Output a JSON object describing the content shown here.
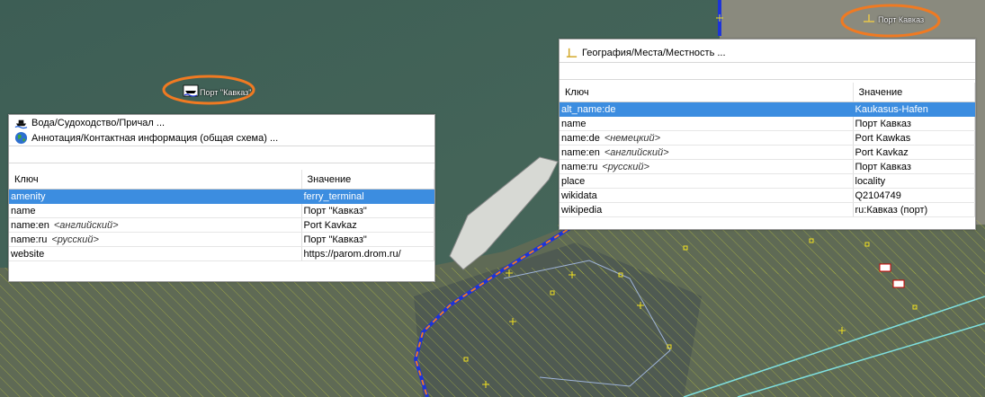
{
  "map": {
    "colors": {
      "sea": "#44665a",
      "land": "#6b735c",
      "highlight": "#f07a22",
      "route": "#1d34d8"
    },
    "labels": [
      {
        "id": "ferry-terminal",
        "text": "Порт \"Кавказ\""
      },
      {
        "id": "locality",
        "text": "Порт Кавказ"
      }
    ]
  },
  "left_panel": {
    "presets": [
      {
        "icon": "ferry-icon",
        "label": "Вода/Судоходство/Причал ..."
      },
      {
        "icon": "globe-icon",
        "label": "Аннотация/Контактная информация (общая схема) ..."
      }
    ],
    "columns": {
      "key": "Ключ",
      "value": "Значение"
    },
    "rows": [
      {
        "key": "amenity",
        "hint": "",
        "value": "ferry_terminal",
        "selected": true
      },
      {
        "key": "name",
        "hint": "",
        "value": "Порт \"Кавказ\"",
        "selected": false
      },
      {
        "key": "name:en",
        "hint": "<английский>",
        "value": "Port Kavkaz",
        "selected": false
      },
      {
        "key": "name:ru",
        "hint": "<русский>",
        "value": "Порт \"Кавказ\"",
        "selected": false
      },
      {
        "key": "website",
        "hint": "",
        "value": "https://parom.drom.ru/",
        "selected": false
      }
    ]
  },
  "right_panel": {
    "presets": [
      {
        "icon": "locality-icon",
        "label": "География/Места/Местность ..."
      }
    ],
    "columns": {
      "key": "Ключ",
      "value": "Значение"
    },
    "rows": [
      {
        "key": "alt_name:de",
        "hint": "",
        "value": "Kaukasus-Hafen",
        "selected": true
      },
      {
        "key": "name",
        "hint": "",
        "value": "Порт Кавказ",
        "selected": false
      },
      {
        "key": "name:de",
        "hint": "<немецкий>",
        "value": "Port Kawkas",
        "selected": false
      },
      {
        "key": "name:en",
        "hint": "<английский>",
        "value": "Port Kavkaz",
        "selected": false
      },
      {
        "key": "name:ru",
        "hint": "<русский>",
        "value": "Порт Кавказ",
        "selected": false
      },
      {
        "key": "place",
        "hint": "",
        "value": "locality",
        "selected": false
      },
      {
        "key": "wikidata",
        "hint": "",
        "value": "Q2104749",
        "selected": false
      },
      {
        "key": "wikipedia",
        "hint": "",
        "value": "ru:Кавказ (порт)",
        "selected": false
      }
    ]
  }
}
